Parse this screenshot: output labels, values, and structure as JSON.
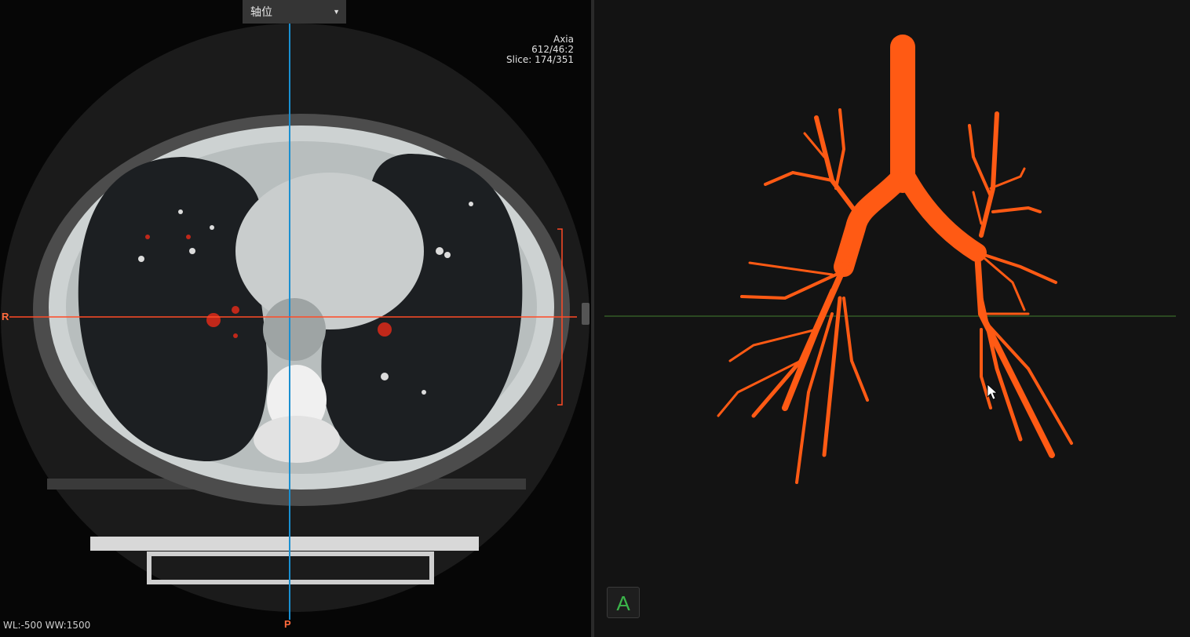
{
  "view_selector": {
    "value": "轴位"
  },
  "overlay_info": {
    "line1": "Axia",
    "line2": "612/46:2",
    "line3": "Slice: 174/351"
  },
  "window_level": "WL:-500 WW:1500",
  "orientation_labels": {
    "right": "R",
    "posterior": "P"
  },
  "vr_orientation_button": "A",
  "colors": {
    "crosshair_vertical": "#1a8fd0",
    "crosshair_horizontal": "#ff4b26",
    "airway": "#ff5a14",
    "vr_reference_line": "#3a6a2a"
  },
  "icons": {
    "dropdown": "chevron-down-icon",
    "cursor": "mouse-pointer-icon"
  }
}
